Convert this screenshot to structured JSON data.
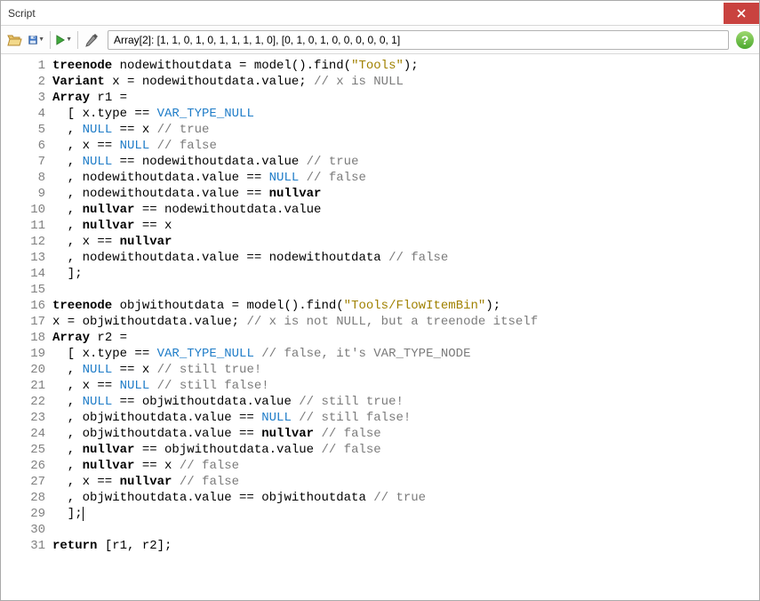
{
  "window": {
    "title": "Script"
  },
  "toolbar": {
    "output": "Array[2]: [1, 1, 0, 1, 0, 1, 1, 1, 1, 0], [0, 1, 0, 1, 0, 0, 0, 0, 0, 1]"
  },
  "lines": [
    {
      "n": 1,
      "seg": [
        {
          "c": "kw",
          "t": "treenode "
        },
        {
          "t": "nodewithoutdata = model().find("
        },
        {
          "c": "str",
          "t": "\"Tools\""
        },
        {
          "t": ");"
        }
      ]
    },
    {
      "n": 2,
      "seg": [
        {
          "c": "kw",
          "t": "Variant "
        },
        {
          "t": "x = nodewithoutdata.value; "
        },
        {
          "c": "com",
          "t": "// x is NULL"
        }
      ]
    },
    {
      "n": 3,
      "seg": [
        {
          "c": "kw",
          "t": "Array "
        },
        {
          "t": "r1 ="
        }
      ]
    },
    {
      "n": 4,
      "seg": [
        {
          "t": "  [ x.type == "
        },
        {
          "c": "const",
          "t": "VAR_TYPE_NULL"
        }
      ]
    },
    {
      "n": 5,
      "seg": [
        {
          "t": "  , "
        },
        {
          "c": "const",
          "t": "NULL"
        },
        {
          "t": " == x "
        },
        {
          "c": "com",
          "t": "// true"
        }
      ]
    },
    {
      "n": 6,
      "seg": [
        {
          "t": "  , x == "
        },
        {
          "c": "const",
          "t": "NULL"
        },
        {
          "t": " "
        },
        {
          "c": "com",
          "t": "// false"
        }
      ]
    },
    {
      "n": 7,
      "seg": [
        {
          "t": "  , "
        },
        {
          "c": "const",
          "t": "NULL"
        },
        {
          "t": " == nodewithoutdata.value "
        },
        {
          "c": "com",
          "t": "// true"
        }
      ]
    },
    {
      "n": 8,
      "seg": [
        {
          "t": "  , nodewithoutdata.value == "
        },
        {
          "c": "const",
          "t": "NULL"
        },
        {
          "t": " "
        },
        {
          "c": "com",
          "t": "// false"
        }
      ]
    },
    {
      "n": 9,
      "seg": [
        {
          "t": "  , nodewithoutdata.value == "
        },
        {
          "c": "kw",
          "t": "nullvar"
        }
      ]
    },
    {
      "n": 10,
      "seg": [
        {
          "t": "  , "
        },
        {
          "c": "kw",
          "t": "nullvar"
        },
        {
          "t": " == nodewithoutdata.value"
        }
      ]
    },
    {
      "n": 11,
      "seg": [
        {
          "t": "  , "
        },
        {
          "c": "kw",
          "t": "nullvar"
        },
        {
          "t": " == x"
        }
      ]
    },
    {
      "n": 12,
      "seg": [
        {
          "t": "  , x == "
        },
        {
          "c": "kw",
          "t": "nullvar"
        }
      ]
    },
    {
      "n": 13,
      "seg": [
        {
          "t": "  , nodewithoutdata.value == nodewithoutdata "
        },
        {
          "c": "com",
          "t": "// false"
        }
      ]
    },
    {
      "n": 14,
      "seg": [
        {
          "t": "  ];"
        }
      ]
    },
    {
      "n": 15,
      "seg": [
        {
          "t": ""
        }
      ]
    },
    {
      "n": 16,
      "seg": [
        {
          "c": "kw",
          "t": "treenode "
        },
        {
          "t": "objwithoutdata = model().find("
        },
        {
          "c": "str",
          "t": "\"Tools/FlowItemBin\""
        },
        {
          "t": ");"
        }
      ]
    },
    {
      "n": 17,
      "seg": [
        {
          "t": "x = objwithoutdata.value; "
        },
        {
          "c": "com",
          "t": "// x is not NULL, but a treenode itself"
        }
      ]
    },
    {
      "n": 18,
      "seg": [
        {
          "c": "kw",
          "t": "Array "
        },
        {
          "t": "r2 ="
        }
      ]
    },
    {
      "n": 19,
      "seg": [
        {
          "t": "  [ x.type == "
        },
        {
          "c": "const",
          "t": "VAR_TYPE_NULL"
        },
        {
          "t": " "
        },
        {
          "c": "com",
          "t": "// false, it's VAR_TYPE_NODE"
        }
      ]
    },
    {
      "n": 20,
      "seg": [
        {
          "t": "  , "
        },
        {
          "c": "const",
          "t": "NULL"
        },
        {
          "t": " == x "
        },
        {
          "c": "com",
          "t": "// still true!"
        }
      ]
    },
    {
      "n": 21,
      "seg": [
        {
          "t": "  , x == "
        },
        {
          "c": "const",
          "t": "NULL"
        },
        {
          "t": " "
        },
        {
          "c": "com",
          "t": "// still false!"
        }
      ]
    },
    {
      "n": 22,
      "seg": [
        {
          "t": "  , "
        },
        {
          "c": "const",
          "t": "NULL"
        },
        {
          "t": " == objwithoutdata.value "
        },
        {
          "c": "com",
          "t": "// still true!"
        }
      ]
    },
    {
      "n": 23,
      "seg": [
        {
          "t": "  , objwithoutdata.value == "
        },
        {
          "c": "const",
          "t": "NULL"
        },
        {
          "t": " "
        },
        {
          "c": "com",
          "t": "// still false!"
        }
      ]
    },
    {
      "n": 24,
      "seg": [
        {
          "t": "  , objwithoutdata.value == "
        },
        {
          "c": "kw",
          "t": "nullvar"
        },
        {
          "t": " "
        },
        {
          "c": "com",
          "t": "// false"
        }
      ]
    },
    {
      "n": 25,
      "seg": [
        {
          "t": "  , "
        },
        {
          "c": "kw",
          "t": "nullvar"
        },
        {
          "t": " == objwithoutdata.value "
        },
        {
          "c": "com",
          "t": "// false"
        }
      ]
    },
    {
      "n": 26,
      "seg": [
        {
          "t": "  , "
        },
        {
          "c": "kw",
          "t": "nullvar"
        },
        {
          "t": " == x "
        },
        {
          "c": "com",
          "t": "// false"
        }
      ]
    },
    {
      "n": 27,
      "seg": [
        {
          "t": "  , x == "
        },
        {
          "c": "kw",
          "t": "nullvar"
        },
        {
          "t": " "
        },
        {
          "c": "com",
          "t": "// false"
        }
      ]
    },
    {
      "n": 28,
      "seg": [
        {
          "t": "  , objwithoutdata.value == objwithoutdata "
        },
        {
          "c": "com",
          "t": "// true"
        }
      ]
    },
    {
      "n": 29,
      "seg": [
        {
          "t": "  ];"
        }
      ],
      "cursor": true
    },
    {
      "n": 30,
      "seg": [
        {
          "t": ""
        }
      ]
    },
    {
      "n": 31,
      "seg": [
        {
          "c": "kw",
          "t": "return "
        },
        {
          "t": "[r1, r2];"
        }
      ]
    }
  ]
}
